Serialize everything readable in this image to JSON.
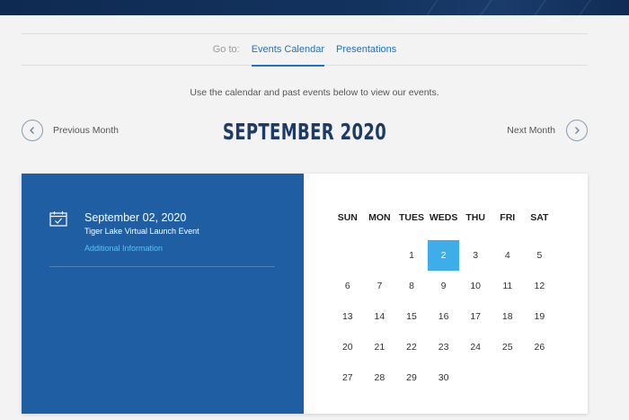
{
  "nav": {
    "goto_label": "Go to:",
    "links": [
      "Events Calendar",
      "Presentations"
    ]
  },
  "instructions": "Use the calendar and past events below to view our events.",
  "month_nav": {
    "previous_label": "Previous Month",
    "next_label": "Next Month",
    "title": "SEPTEMBER 2020"
  },
  "event": {
    "date": "September 02, 2020",
    "name": "Tiger Lake Virtual Launch Event",
    "link": "Additional Information",
    "icon": "calendar-check-icon"
  },
  "calendar": {
    "weekdays": [
      "SUN",
      "MON",
      "TUES",
      "WEDS",
      "THU",
      "FRI",
      "SAT"
    ],
    "weeks": [
      [
        "",
        "",
        "1",
        "2",
        "3",
        "4",
        "5"
      ],
      [
        "6",
        "7",
        "8",
        "9",
        "10",
        "11",
        "12"
      ],
      [
        "13",
        "14",
        "15",
        "16",
        "17",
        "18",
        "19"
      ],
      [
        "20",
        "21",
        "22",
        "23",
        "24",
        "25",
        "26"
      ],
      [
        "27",
        "28",
        "29",
        "30",
        "",
        "",
        ""
      ]
    ],
    "selected_day": "2"
  },
  "colors": {
    "event_panel": "#205ea4",
    "selected_day": "#3daee9",
    "link": "#1f73c5",
    "title": "#1e3a66"
  }
}
